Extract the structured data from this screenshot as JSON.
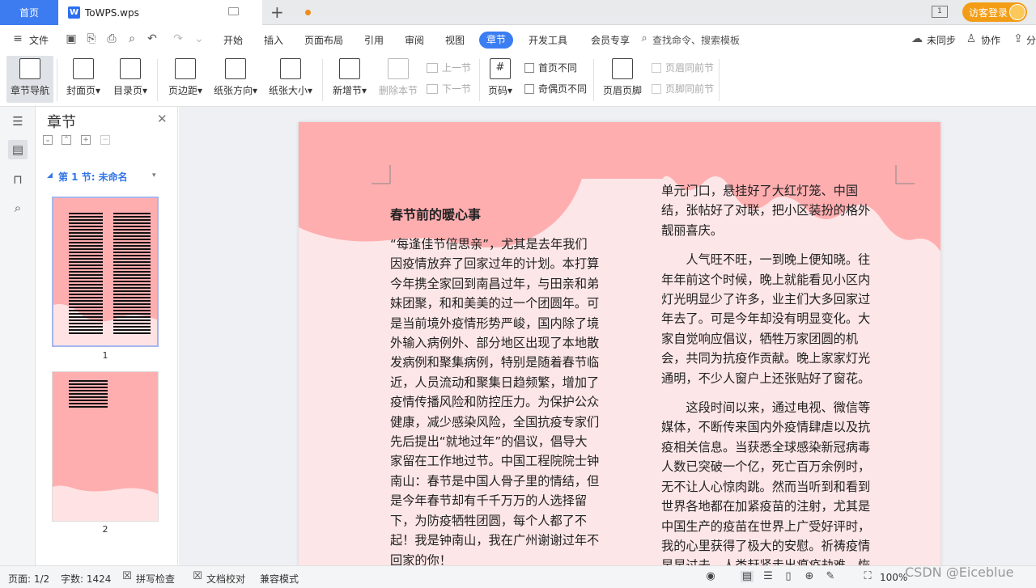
{
  "tabs": {
    "home": "首页",
    "doc_title": "ToWPS.wps",
    "layout_icon_text": "1"
  },
  "login_button": "访客登录",
  "menu": {
    "file": "文件",
    "items": [
      "开始",
      "插入",
      "页面布局",
      "引用",
      "审阅",
      "视图",
      "章节",
      "开发工具",
      "会员专享"
    ],
    "active": "章节",
    "search": "查找命令、搜索模板",
    "right": [
      "未同步",
      "协作",
      "分"
    ]
  },
  "ribbon": {
    "chapter_nav": "章节导航",
    "cover": "封面页",
    "toc": "目录页",
    "margin": "页边距",
    "orientation": "纸张方向",
    "size": "纸张大小",
    "new_section": "新增节",
    "delete_section": "删除本节",
    "prev_section": "上一节",
    "next_section": "下一节",
    "page_number": "页码",
    "first_page_diff": "首页不同",
    "odd_even_diff": "奇偶页不同",
    "header_footer": "页眉页脚",
    "header_same_prev": "页眉同前节",
    "footer_same_prev": "页脚同前节"
  },
  "sidepanel": {
    "title": "章节",
    "section_label": "第 1 节: 未命名",
    "thumbnails": [
      {
        "label": "1"
      },
      {
        "label": "2"
      }
    ]
  },
  "document": {
    "title": "春节前的暖心事",
    "col1": [
      "“每逢佳节倍思亲”，尤其是去年我们",
      "因疫情放弃了回家过年的计划。本打算",
      "今年携全家回到南昌过年，与田亲和弟",
      "妹团聚，和和美美的过一个团圆年。可",
      "是当前境外疫情形势严峻，国内除了境",
      "外输入病例外、部分地区出现了本地散",
      "发病例和聚集病例，特别是随着春节临",
      "近，人员流动和聚集日趋频繁，增加了",
      "疫情传播风险和防控压力。为保护公众",
      "健康，减少感染风险，全国抗疫专家们",
      "先后提出“就地过年”的倡议，倡导大",
      "家留在工作地过节。中国工程院院士钟",
      "南山：春节是中国人骨子里的情结，但",
      "是今年春节却有千千万万的人选择留",
      "下，为防疫牺牲团圆，每个人都了不",
      "起！我是钟南山，我在广州谢谢过年不",
      "回家的你！"
    ],
    "col2_p1": [
      "单元门口，悬挂好了大红灯笼、中国",
      "结，张帖好了对联，把小区装扮的格外",
      "靓丽喜庆。"
    ],
    "col2_p2": [
      "　　人气旺不旺，一到晚上便知晓。往",
      "年年前这个时候，晚上就能看见小区内",
      "灯光明显少了许多，业主们大多回家过",
      "年去了。可是今年却没有明显变化。大",
      "家自觉响应倡议，牺牲万家团圆的机",
      "会，共同为抗疫作贡献。晚上家家灯光",
      "通明，不少人窗户上还张贴好了窗花。"
    ],
    "col2_p3": [
      "　　这段时间以来，通过电视、微信等",
      "媒体，不断传来国内外疫情肆虐以及抗",
      "疫相关信息。当获悉全球感染新冠病毒",
      "人数已突破一个亿，死亡百万余例时，",
      "无不让人心惊肉跳。然而当听到和看到",
      "世界各地都在加紧疫苗的注射，尤其是",
      "中国生产的疫苗在世界上广受好评时，",
      "我的心里获得了极大的安慰。祈祷疫情",
      "早早过去，人类赶紧走出瘟疫劫难，恢"
    ]
  },
  "status": {
    "page": "页面: 1/2",
    "words": "字数: 1424",
    "spell": "拼写检查",
    "proof": "文档校对",
    "compat": "兼容模式",
    "zoom": "100%"
  },
  "watermark": "CSDN @Eiceblue",
  "colors": {
    "accent": "#3a7ef2",
    "page_bg": "#fde6e7",
    "page_wave": "#ffaeb0",
    "login": "#f39d17"
  }
}
